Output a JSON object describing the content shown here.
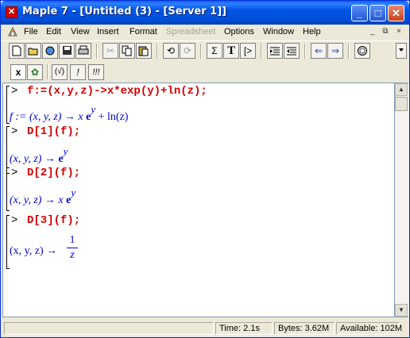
{
  "window": {
    "title": "Maple 7  - [Untitled (3) - [Server 1]]",
    "controls": {
      "minimize": "_",
      "maximize": "□",
      "close": "✕"
    }
  },
  "menubar": {
    "items": [
      "File",
      "Edit",
      "View",
      "Insert",
      "Format",
      "Spreadsheet",
      "Options",
      "Window",
      "Help"
    ],
    "disabled": [
      "Spreadsheet"
    ],
    "mdi": {
      "minimize": "_",
      "restore": "⧉",
      "close": "×"
    }
  },
  "toolbar": {
    "spreadsheet_tools": {
      "x": "x",
      "leaf": "✿"
    },
    "math_buttons": [
      "(√)",
      "!",
      "!!!"
    ],
    "text_buttons": {
      "sigma": "Σ",
      "text": "T",
      "prompt": "[>",
      "back": "⇐",
      "forward": "⇒"
    }
  },
  "worksheet": {
    "prompt_symbol": ">",
    "commands": [
      "f:=(x,y,z)->x*exp(y)+ln(z);",
      "D[1](f);",
      "D[2](f);",
      "D[3](f);"
    ],
    "outputs": {
      "o1": {
        "lhs": "f := (x, y, z) → x",
        "e": "e",
        "sup": "y",
        "tail": "+ ln(z)"
      },
      "o2": {
        "lhs": "(x, y, z) →",
        "e": "e",
        "sup": "y"
      },
      "o3": {
        "lhs": "(x, y, z) → x",
        "e": "e",
        "sup": "y"
      },
      "o4": {
        "lhs": "(x, y, z) →",
        "num": "1",
        "den": "z"
      }
    }
  },
  "statusbar": {
    "time": "Time:   2.1s",
    "bytes": "Bytes: 3.62M",
    "available": "Available: 102M"
  }
}
